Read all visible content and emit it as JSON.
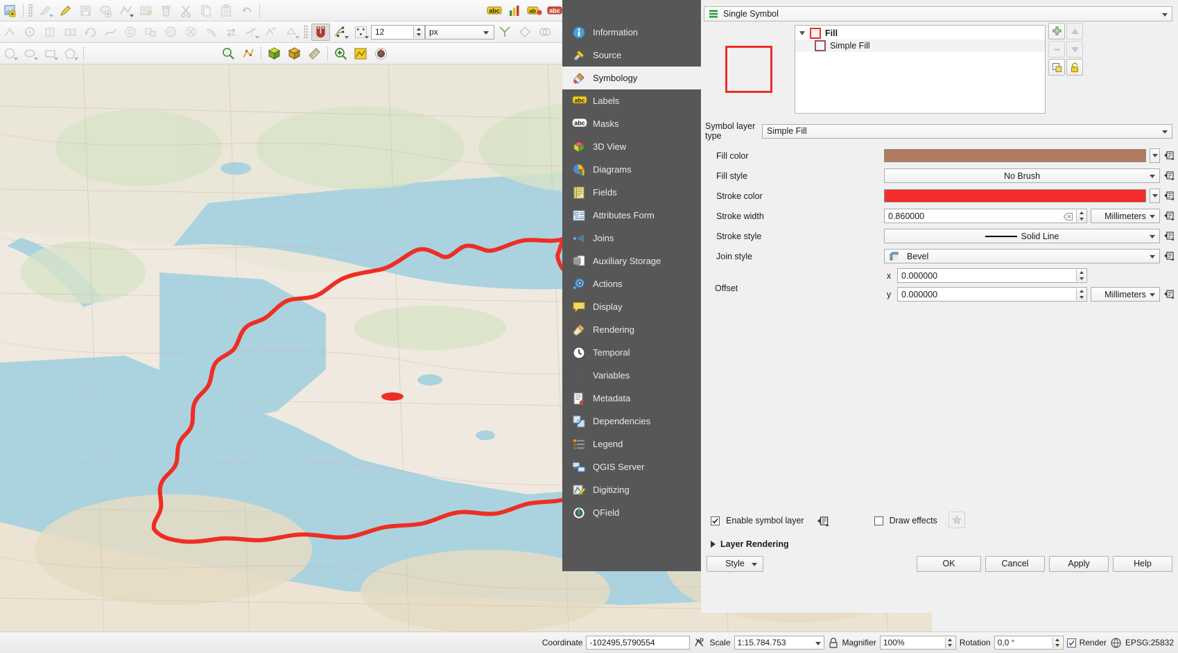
{
  "toolbars": {
    "row1": [
      {
        "name": "current-edits-icon",
        "title": "Current Edits"
      },
      {
        "name": "toggle-editing-icon",
        "title": "Toggle Editing"
      },
      {
        "name": "edit-pencil-icon",
        "title": "Edit"
      },
      {
        "name": "save-layer-edits-icon",
        "title": "Save Layer Edits"
      },
      {
        "name": "add-feature-icon",
        "title": "Add Feature"
      },
      {
        "name": "vertex-tool-icon",
        "title": "Vertex Tool"
      },
      {
        "name": "modify-attributes-icon",
        "title": "Modify Attributes of Selected Features"
      },
      {
        "name": "delete-selected-icon",
        "title": "Delete Selected"
      },
      {
        "name": "cut-features-icon",
        "title": "Cut Features"
      },
      {
        "name": "copy-features-icon",
        "title": "Copy Features"
      },
      {
        "name": "paste-features-icon",
        "title": "Paste Features"
      },
      {
        "name": "undo-icon",
        "title": "Undo"
      }
    ],
    "snapping": {
      "size_value": "12",
      "size_unit": "px"
    }
  },
  "search": {
    "placeholder": "",
    "value": ""
  },
  "nav": {
    "items": [
      {
        "label": "Information",
        "icon": "information-icon",
        "selected": false
      },
      {
        "label": "Source",
        "icon": "source-icon",
        "selected": false
      },
      {
        "label": "Symbology",
        "icon": "symbology-icon",
        "selected": true
      },
      {
        "label": "Labels",
        "icon": "labels-icon",
        "selected": false
      },
      {
        "label": "Masks",
        "icon": "masks-icon",
        "selected": false
      },
      {
        "label": "3D View",
        "icon": "3d-view-icon",
        "selected": false
      },
      {
        "label": "Diagrams",
        "icon": "diagrams-icon",
        "selected": false
      },
      {
        "label": "Fields",
        "icon": "fields-icon",
        "selected": false
      },
      {
        "label": "Attributes Form",
        "icon": "attributes-form-icon",
        "selected": false
      },
      {
        "label": "Joins",
        "icon": "joins-icon",
        "selected": false
      },
      {
        "label": "Auxiliary Storage",
        "icon": "auxiliary-storage-icon",
        "selected": false
      },
      {
        "label": "Actions",
        "icon": "actions-icon",
        "selected": false
      },
      {
        "label": "Display",
        "icon": "display-icon",
        "selected": false
      },
      {
        "label": "Rendering",
        "icon": "rendering-icon",
        "selected": false
      },
      {
        "label": "Temporal",
        "icon": "temporal-icon",
        "selected": false
      },
      {
        "label": "Variables",
        "icon": "variables-icon",
        "selected": false
      },
      {
        "label": "Metadata",
        "icon": "metadata-icon",
        "selected": false
      },
      {
        "label": "Dependencies",
        "icon": "dependencies-icon",
        "selected": false
      },
      {
        "label": "Legend",
        "icon": "legend-icon",
        "selected": false
      },
      {
        "label": "QGIS Server",
        "icon": "qgis-server-icon",
        "selected": false
      },
      {
        "label": "Digitizing",
        "icon": "digitizing-icon",
        "selected": false
      },
      {
        "label": "QField",
        "icon": "qfield-icon",
        "selected": false
      }
    ]
  },
  "symbology": {
    "renderer": "Single Symbol",
    "tree": {
      "root": "Fill",
      "child": "Simple Fill"
    },
    "side_buttons": [
      {
        "name": "add-symbol-layer-button",
        "label": "+"
      },
      {
        "name": "move-symbol-layer-up-button",
        "label": "up"
      },
      {
        "name": "remove-symbol-layer-button",
        "label": "-"
      },
      {
        "name": "move-symbol-layer-down-button",
        "label": "down"
      },
      {
        "name": "duplicate-symbol-layer-button",
        "label": "duplicate"
      },
      {
        "name": "lock-symbol-layer-button",
        "label": "lock"
      }
    ],
    "symbol_layer_type": {
      "label": "Symbol layer type",
      "value": "Simple Fill"
    },
    "fields": [
      {
        "key": "fill_color",
        "label": "Fill color",
        "type": "color",
        "value": "#b07a5f"
      },
      {
        "key": "fill_style",
        "label": "Fill style",
        "type": "combo",
        "value": "No Brush"
      },
      {
        "key": "stroke_color",
        "label": "Stroke color",
        "type": "color",
        "value": "#f42c2c"
      },
      {
        "key": "stroke_width",
        "label": "Stroke width",
        "type": "spin",
        "value": "0.860000",
        "unit": "Millimeters"
      },
      {
        "key": "stroke_style",
        "label": "Stroke style",
        "type": "combo-line",
        "value": "Solid Line"
      },
      {
        "key": "join_style",
        "label": "Join style",
        "type": "combo-icon",
        "value": "Bevel"
      }
    ],
    "offset": {
      "label": "Offset",
      "x_label": "x",
      "x_value": "0.000000",
      "y_label": "y",
      "y_value": "0.000000",
      "unit": "Millimeters"
    },
    "enable_symbol_layer": {
      "label": "Enable symbol layer",
      "checked": true
    },
    "draw_effects": {
      "label": "Draw effects",
      "checked": false
    },
    "layer_rendering": {
      "label": "Layer Rendering",
      "expanded": false
    }
  },
  "dialog_buttons": {
    "style": "Style",
    "ok": "OK",
    "cancel": "Cancel",
    "apply": "Apply",
    "help": "Help"
  },
  "statusbar": {
    "coordinate_label": "Coordinate",
    "coordinate_value": "-102495,5790554",
    "scale_label": "Scale",
    "scale_value": "1:15.784.753",
    "magnifier_label": "Magnifier",
    "magnifier_value": "100%",
    "rotation_label": "Rotation",
    "rotation_value": "0,0 °",
    "render_label": "Render",
    "render_checked": true,
    "crs_value": "EPSG:25832"
  },
  "colors": {
    "accent_red": "#ee2e24",
    "nav_bg": "#575757",
    "sea": "#aad3df",
    "land": "#efe9df"
  }
}
